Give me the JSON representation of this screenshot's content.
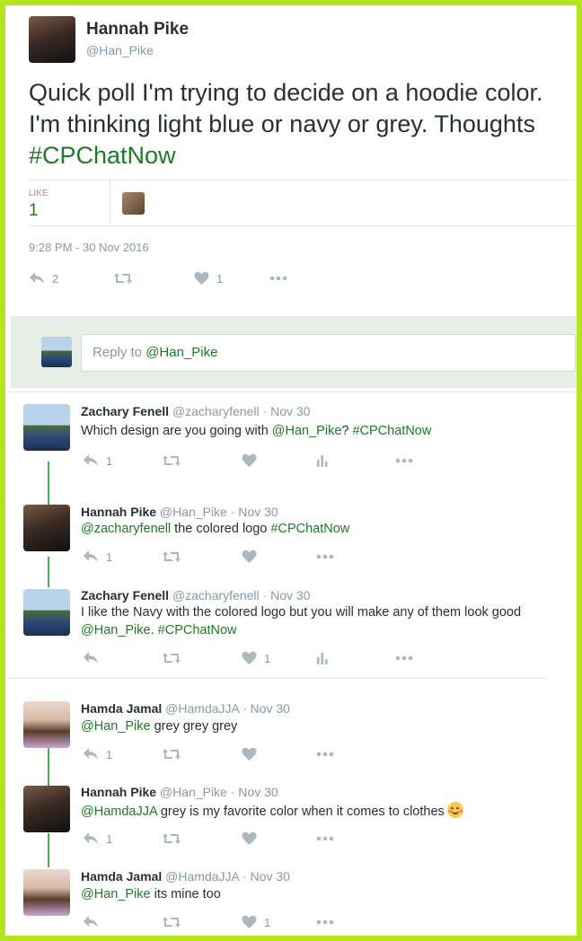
{
  "main_tweet": {
    "name": "Hannah Pike",
    "handle": "@Han_Pike",
    "text_before": "Quick poll I'm trying to decide on a hoodie color. I'm thinking light blue or navy or grey. Thoughts ",
    "hashtag": "#CPChatNow",
    "like_label": "LIKE",
    "like_count": "1",
    "timestamp": "9:28 PM - 30 Nov 2016",
    "reply_count": "2",
    "favorite_count": "1"
  },
  "reply_box": {
    "prefix": "Reply to ",
    "mention": "@Han_Pike"
  },
  "threads": [
    {
      "name": "Zachary Fenell",
      "handle": "@zacharyfenell",
      "time": "Nov 30",
      "mention": "",
      "text": "Which design are you going with ",
      "mention2": "@Han_Pike",
      "text2": "? ",
      "hashtag": "#CPChatNow",
      "reply_count": "1",
      "favorite_count": ""
    },
    {
      "name": "Hannah Pike",
      "handle": "@Han_Pike",
      "time": "Nov 30",
      "mention": "@zacharyfenell",
      "text": " the colored logo ",
      "hashtag": "#CPChatNow",
      "reply_count": "1",
      "favorite_count": ""
    },
    {
      "name": "Zachary Fenell",
      "handle": "@zacharyfenell",
      "time": "Nov 30",
      "line1": "I like the Navy with the colored logo but you will make any of them look good",
      "mention": "@Han_Pike",
      "text": ". ",
      "hashtag": "#CPChatNow",
      "reply_count": "",
      "favorite_count": "1"
    },
    {
      "name": "Hamda Jamal",
      "handle": "@HamdaJJA",
      "time": "Nov 30",
      "mention": "@Han_Pike",
      "text": " grey grey grey",
      "reply_count": "1",
      "favorite_count": ""
    },
    {
      "name": "Hannah Pike",
      "handle": "@Han_Pike",
      "time": "Nov 30",
      "mention": "@HamdaJJA",
      "text": " grey is my favorite color when it comes to clothes",
      "reply_count": "1",
      "favorite_count": ""
    },
    {
      "name": "Hamda Jamal",
      "handle": "@HamdaJJA",
      "time": "Nov 30",
      "mention": "@Han_Pike",
      "text": " its mine too",
      "reply_count": "",
      "favorite_count": "1"
    }
  ],
  "separator": "·",
  "icons": [
    "reply-icon",
    "retweet-icon",
    "heart-icon",
    "analytics-icon",
    "more-icon",
    "smile-emoji-icon"
  ],
  "colors": {
    "frame": "#b5e61d",
    "link": "#1e7b25",
    "reply_bg": "#e6efe6",
    "thread_line": "#4caf50"
  }
}
